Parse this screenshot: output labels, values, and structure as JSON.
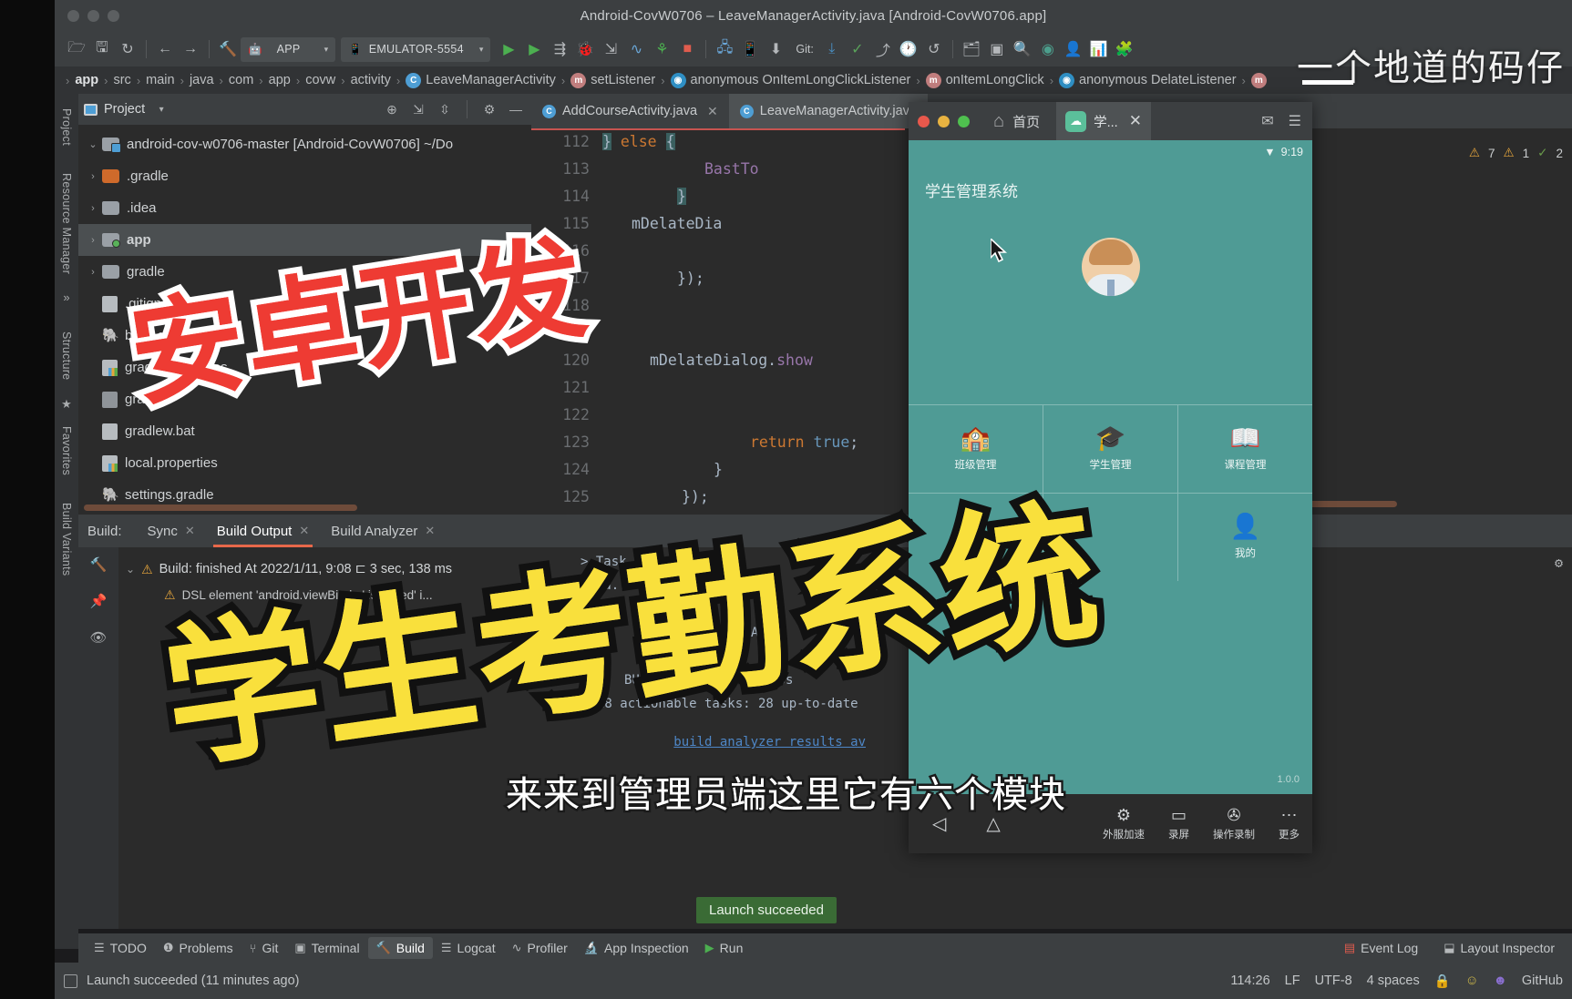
{
  "window": {
    "title": "Android-CovW0706 – LeaveManagerActivity.java [Android-CovW0706.app]"
  },
  "toolbar": {
    "icons": [
      "open-folder-icon",
      "save-icon",
      "sync-icon",
      "back-arrow-icon",
      "forward-arrow-icon",
      "build-hammer-icon"
    ],
    "app_config": {
      "label": "APP",
      "caret": "▾"
    },
    "device": {
      "label": "EMULATOR-5554",
      "caret": "▾"
    },
    "git_label": "Git:",
    "run_icons": [
      "run-icon",
      "debug-run-icon",
      "apply-changes-icon",
      "debug-bug-icon",
      "attach-debugger-icon",
      "profile-icon",
      "device-manager-icon",
      "stop-icon"
    ],
    "vcs_icons": [
      "update-icon",
      "commit-icon",
      "push-icon",
      "history-icon",
      "rollback-icon"
    ],
    "right_icons": [
      "project-structure-icon",
      "sdk-manager-icon",
      "search-icon",
      "avd-manager-icon",
      "layout-inspector-icon"
    ]
  },
  "breadcrumb": {
    "items": [
      {
        "label": "app",
        "bold": true,
        "icon": null
      },
      {
        "label": "src",
        "bold": false,
        "icon": null
      },
      {
        "label": "main",
        "bold": false,
        "icon": null
      },
      {
        "label": "java",
        "bold": false,
        "icon": null
      },
      {
        "label": "com",
        "bold": false,
        "icon": null
      },
      {
        "label": "app",
        "bold": false,
        "icon": null
      },
      {
        "label": "covw",
        "bold": false,
        "icon": null
      },
      {
        "label": "activity",
        "bold": false,
        "icon": null
      },
      {
        "label": "LeaveManagerActivity",
        "bold": false,
        "icon": "class-icon",
        "glyph": "C"
      },
      {
        "label": "setListener",
        "bold": false,
        "icon": "method-icon",
        "glyph": "m"
      },
      {
        "label": "anonymous OnItemLongClickListener",
        "bold": false,
        "icon": "anonymous-class-icon",
        "glyph": "◉"
      },
      {
        "label": "onItemLongClick",
        "bold": false,
        "icon": "method-icon",
        "glyph": "m"
      },
      {
        "label": "anonymous DelateListener",
        "bold": false,
        "icon": "anonymous-class-icon",
        "glyph": "◉"
      }
    ]
  },
  "left_rail": {
    "items": [
      "Project",
      "Resource Manager",
      "Structure",
      "Favorites",
      "Build Variants"
    ]
  },
  "project_panel": {
    "title": "Project",
    "header_icons": [
      "locate-icon",
      "collapse-all-icon",
      "expand-icon",
      "settings-gear-icon",
      "minimize-icon"
    ],
    "tree": [
      {
        "label": "android-cov-w0706-master [Android-CovW0706] ~/Do",
        "arrow": "⌄",
        "type": "module-folder",
        "bold_part": "[Android-CovW0706]",
        "depth": 0,
        "selected": false
      },
      {
        "label": ".gradle",
        "arrow": "›",
        "type": "folder-orange",
        "depth": 1,
        "selected": false
      },
      {
        "label": ".idea",
        "arrow": "›",
        "type": "folder",
        "depth": 1,
        "selected": false
      },
      {
        "label": "app",
        "arrow": "›",
        "type": "folder-green",
        "depth": 1,
        "selected": true
      },
      {
        "label": "gradle",
        "arrow": "›",
        "type": "folder",
        "depth": 1,
        "selected": false
      },
      {
        "label": ".gitignore",
        "arrow": "",
        "type": "file-ignored",
        "depth": 1,
        "selected": false
      },
      {
        "label": "build.gradle",
        "arrow": "",
        "type": "file-gradle",
        "depth": 1,
        "selected": false
      },
      {
        "label": "gradle.properties",
        "arrow": "",
        "type": "file-properties",
        "depth": 1,
        "selected": false
      },
      {
        "label": "gradlew",
        "arrow": "",
        "type": "file-script",
        "depth": 1,
        "selected": false
      },
      {
        "label": "gradlew.bat",
        "arrow": "",
        "type": "file-text",
        "depth": 1,
        "selected": false
      },
      {
        "label": "local.properties",
        "arrow": "",
        "type": "file-properties",
        "depth": 1,
        "selected": false
      },
      {
        "label": "settings.gradle",
        "arrow": "",
        "type": "file-gradle",
        "depth": 1,
        "selected": false
      }
    ]
  },
  "editor": {
    "tabs": [
      {
        "label": "AddCourseActivity.java",
        "glyph": "C",
        "active": false
      },
      {
        "label": "LeaveManagerActivity.java",
        "glyph": "C",
        "active": true
      }
    ],
    "gutter_lines": [
      "112",
      "113",
      "114",
      "115",
      "116",
      "117",
      "118",
      "119",
      "120",
      "121",
      "122",
      "123",
      "124",
      "125"
    ],
    "code_lines": [
      {
        "line": "112",
        "text": "} else {"
      },
      {
        "line": "113",
        "text": "    BastToast"
      },
      {
        "line": "114",
        "text": "}"
      },
      {
        "line": "115",
        "text": "mDelateDial"
      },
      {
        "line": "116",
        "text": ""
      },
      {
        "line": "117",
        "text": "});"
      },
      {
        "line": "118",
        "text": ""
      },
      {
        "line": "119",
        "text": "mDelateDialog.show"
      },
      {
        "line": "120",
        "text": ""
      },
      {
        "line": "121",
        "text": ""
      },
      {
        "line": "122",
        "text": "return true;"
      },
      {
        "line": "123",
        "text": "}"
      },
      {
        "line": "124",
        "text": "});"
      },
      {
        "line": "125",
        "text": ""
      }
    ]
  },
  "inspection": {
    "warnings": "7",
    "errors": "1",
    "checks": "2",
    "wifi_time": "9:19"
  },
  "build_panel": {
    "label": "Build:",
    "tabs": [
      {
        "label": "Sync",
        "active": false,
        "closable": true
      },
      {
        "label": "Build Output",
        "active": true,
        "closable": true
      },
      {
        "label": "Build Analyzer",
        "active": false,
        "closable": true
      }
    ],
    "gutter_icons": [
      "build-hammer-icon",
      "pin-icon",
      "eye-icon"
    ],
    "tree": [
      {
        "label": "Build: finished At 2022/1/11, 9:08  ⊏ 3 sec, 138 ms",
        "level": 0,
        "icon": "warning-icon",
        "arrow": "⌄"
      },
      {
        "label": "DSL element 'android.viewBind...' is ...bled' i...",
        "level": 1,
        "icon": "warning-icon",
        "arrow": ""
      }
    ],
    "console": [
      "> Task",
      "> Ta...",
      "",
      "",
      "",
      "BUILD SUCCESSFUL in 3s",
      "28 actionable tasks: 28 up-to-date",
      "build analyzer results av"
    ],
    "console_right_labels": [
      "Task",
      "T..."
    ],
    "up_to_date_text": "UP-TO-DATE",
    "toast": "Launch succeeded"
  },
  "tool_window_bar": {
    "items": [
      {
        "label": "TODO",
        "icon": "list-icon",
        "active": false
      },
      {
        "label": "Problems",
        "icon": "warning-circle-icon",
        "active": false
      },
      {
        "label": "Git",
        "icon": "git-branch-icon",
        "active": false
      },
      {
        "label": "Terminal",
        "icon": "terminal-icon",
        "active": false
      },
      {
        "label": "Build",
        "icon": "hammer-icon",
        "active": true
      },
      {
        "label": "Logcat",
        "icon": "logcat-icon",
        "active": false
      },
      {
        "label": "Profiler",
        "icon": "profiler-icon",
        "active": false
      },
      {
        "label": "App Inspection",
        "icon": "inspection-icon",
        "active": false
      },
      {
        "label": "Run",
        "icon": "play-icon",
        "active": false
      }
    ],
    "right_items": [
      {
        "label": "Event Log",
        "icon": "event-log-icon"
      },
      {
        "label": "Layout Inspector",
        "icon": "layout-inspector-icon"
      }
    ]
  },
  "status_bar": {
    "message": "Launch succeeded (11 minutes ago)",
    "caret": "114:26",
    "line_sep": "LF",
    "encoding": "UTF-8",
    "indent": "4 spaces",
    "icons": [
      "lock-icon",
      "smiley-icon",
      "face-icon"
    ],
    "git_branch": "GitHub"
  },
  "emulator": {
    "window_title": "首页",
    "home_label": "首页",
    "tab_label": "学...",
    "tab_close": "✕",
    "right_icons": [
      "mail-icon",
      "menu-icon"
    ],
    "status_time": "9:19",
    "app_title": "学生管理系统",
    "version": "1.0.0",
    "modules": [
      {
        "label": "班级管理",
        "icon": "classroom-icon",
        "glyph": "🏫"
      },
      {
        "label": "学生管理",
        "icon": "student-icon",
        "glyph": "🎓"
      },
      {
        "label": "课程管理",
        "icon": "course-book-icon",
        "glyph": "📖"
      },
      {
        "label": "我的",
        "icon": "profile-icon",
        "glyph": "👤"
      }
    ],
    "nav": {
      "back": "◁",
      "home": "△",
      "recent": ""
    },
    "tools": [
      {
        "label": "外服加速",
        "icon": "rocket-icon",
        "glyph": "⚙"
      },
      {
        "label": "录屏",
        "icon": "record-screen-icon",
        "glyph": "▭"
      },
      {
        "label": "操作录制",
        "icon": "action-record-icon",
        "glyph": "✇"
      },
      {
        "label": "更多",
        "icon": "more-icon",
        "glyph": "⋯"
      }
    ]
  },
  "overlay": {
    "red_title": "安卓开发",
    "yellow_title": "学生考勤系统",
    "subtitle": "来来到管理员端这里它有六个模块",
    "watermark": "一个地道的码仔"
  }
}
